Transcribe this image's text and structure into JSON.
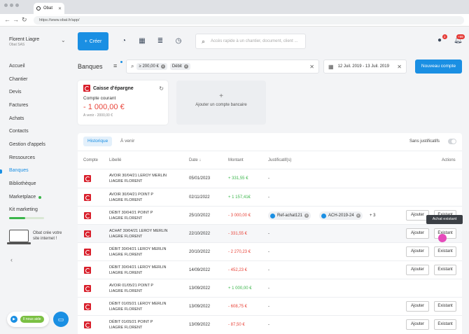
{
  "browser": {
    "tab_title": "Obat",
    "url": "https://www.obat.fr/app/"
  },
  "sidebar": {
    "user_name": "Florent Liagre",
    "company": "Obat SAS",
    "items": [
      {
        "label": "Accueil"
      },
      {
        "label": "Chantier"
      },
      {
        "label": "Devis"
      },
      {
        "label": "Factures"
      },
      {
        "label": "Achats"
      },
      {
        "label": "Contacts"
      },
      {
        "label": "Gestion d'appels"
      },
      {
        "label": "Ressources"
      },
      {
        "label": "Banques"
      },
      {
        "label": "Bibliothèque"
      },
      {
        "label": "Marketplace"
      },
      {
        "label": "Kit marketing"
      }
    ],
    "kit_progress": 0.45,
    "ad_text": "Obat crée votre site internet !",
    "help_badge": "Il nous aide"
  },
  "topbar": {
    "create_label": "Créer",
    "search_placeholder": "Accès rapide à un chantier, document, client ...",
    "chat_badge": "2",
    "notif_badge": "+99"
  },
  "page": {
    "title": "Banques",
    "filters": [
      "≥ 200,00 €",
      "Débit"
    ],
    "date_range": "12 Juil. 2019 - 13 Juil. 2019",
    "new_account_label": "Nouveau compte"
  },
  "account_card": {
    "bank": "Caisse d'épargne",
    "type": "Compte courant",
    "balance": "- 1 000,00 €",
    "upcoming": "A venir - 2000,00 €"
  },
  "add_account_label": "Ajouter un compte bancaire",
  "tabs": [
    "Historique",
    "À venir"
  ],
  "sans_justificatifs_label": "Sans justificatifs",
  "columns": {
    "compte": "Compte",
    "libelle": "Libellé",
    "date": "Date",
    "montant": "Montant",
    "justificatifs": "Justificatif(s)",
    "actions": "Actions"
  },
  "rows": [
    {
      "lib1": "AVOIR 30/04/21 LEROY MERLIN",
      "lib2": "LIAGRE FLORENT",
      "date": "05/01/2023",
      "amount": "+ 331,55 €",
      "sign": "pos",
      "just": "-",
      "actions": false
    },
    {
      "lib1": "AVOIR 30/04/21 POINT P",
      "lib2": "LIAGRE FLORENT",
      "date": "02/11/2022",
      "amount": "+ 1 157,41€",
      "sign": "pos",
      "just": "-",
      "actions": false
    },
    {
      "lib1": "DÉBIT 30/04/21 POINT P",
      "lib2": "LIAGRE FLORENT",
      "date": "25/10/2022",
      "amount": "- 3 000,00 €",
      "sign": "neg",
      "just": "",
      "actions": true
    },
    {
      "lib1": "ACHAT 30/04/21 LEROY MERLIN",
      "lib2": "LIAGRE FLORENT",
      "date": "22/10/2022",
      "amount": "- 331,55 €",
      "sign": "neg",
      "just": "-",
      "actions": true
    },
    {
      "lib1": "DÉBIT 30/04/21 LEROY MERLIN",
      "lib2": "LIAGRE FLORENT",
      "date": "20/10/2022",
      "amount": "- 2 270,23 €",
      "sign": "neg",
      "just": "-",
      "actions": true
    },
    {
      "lib1": "DÉBIT 30/04/21 LEROY MERLIN",
      "lib2": "LIAGRE FLORENT",
      "date": "14/09/2022",
      "amount": "- 452,23 €",
      "sign": "neg",
      "just": "-",
      "actions": true
    },
    {
      "lib1": "AVOIR 01/05/21 POINT P",
      "lib2": "LIAGRE FLORENT",
      "date": "13/09/2022",
      "amount": "+ 1 000,00 €",
      "sign": "pos",
      "just": "-",
      "actions": false
    },
    {
      "lib1": "DÉBIT 01/05/21 LEROY MERLIN",
      "lib2": "LIAGRE FLORENT",
      "date": "13/09/2022",
      "amount": "- 608,75 €",
      "sign": "neg",
      "just": "-",
      "actions": true
    },
    {
      "lib1": "DÉBIT 01/05/21 POINT P",
      "lib2": "LIAGRE FLORENT",
      "date": "13/09/2022",
      "amount": "- 87,50 €",
      "sign": "neg",
      "just": "-",
      "actions": true
    }
  ],
  "justif_pills": [
    "Ref-achat121",
    "ACH-2019-24"
  ],
  "justif_more": "+ 3",
  "action_ajouter": "Ajouter",
  "action_existant": "Existant",
  "tooltip": "Achat existant"
}
